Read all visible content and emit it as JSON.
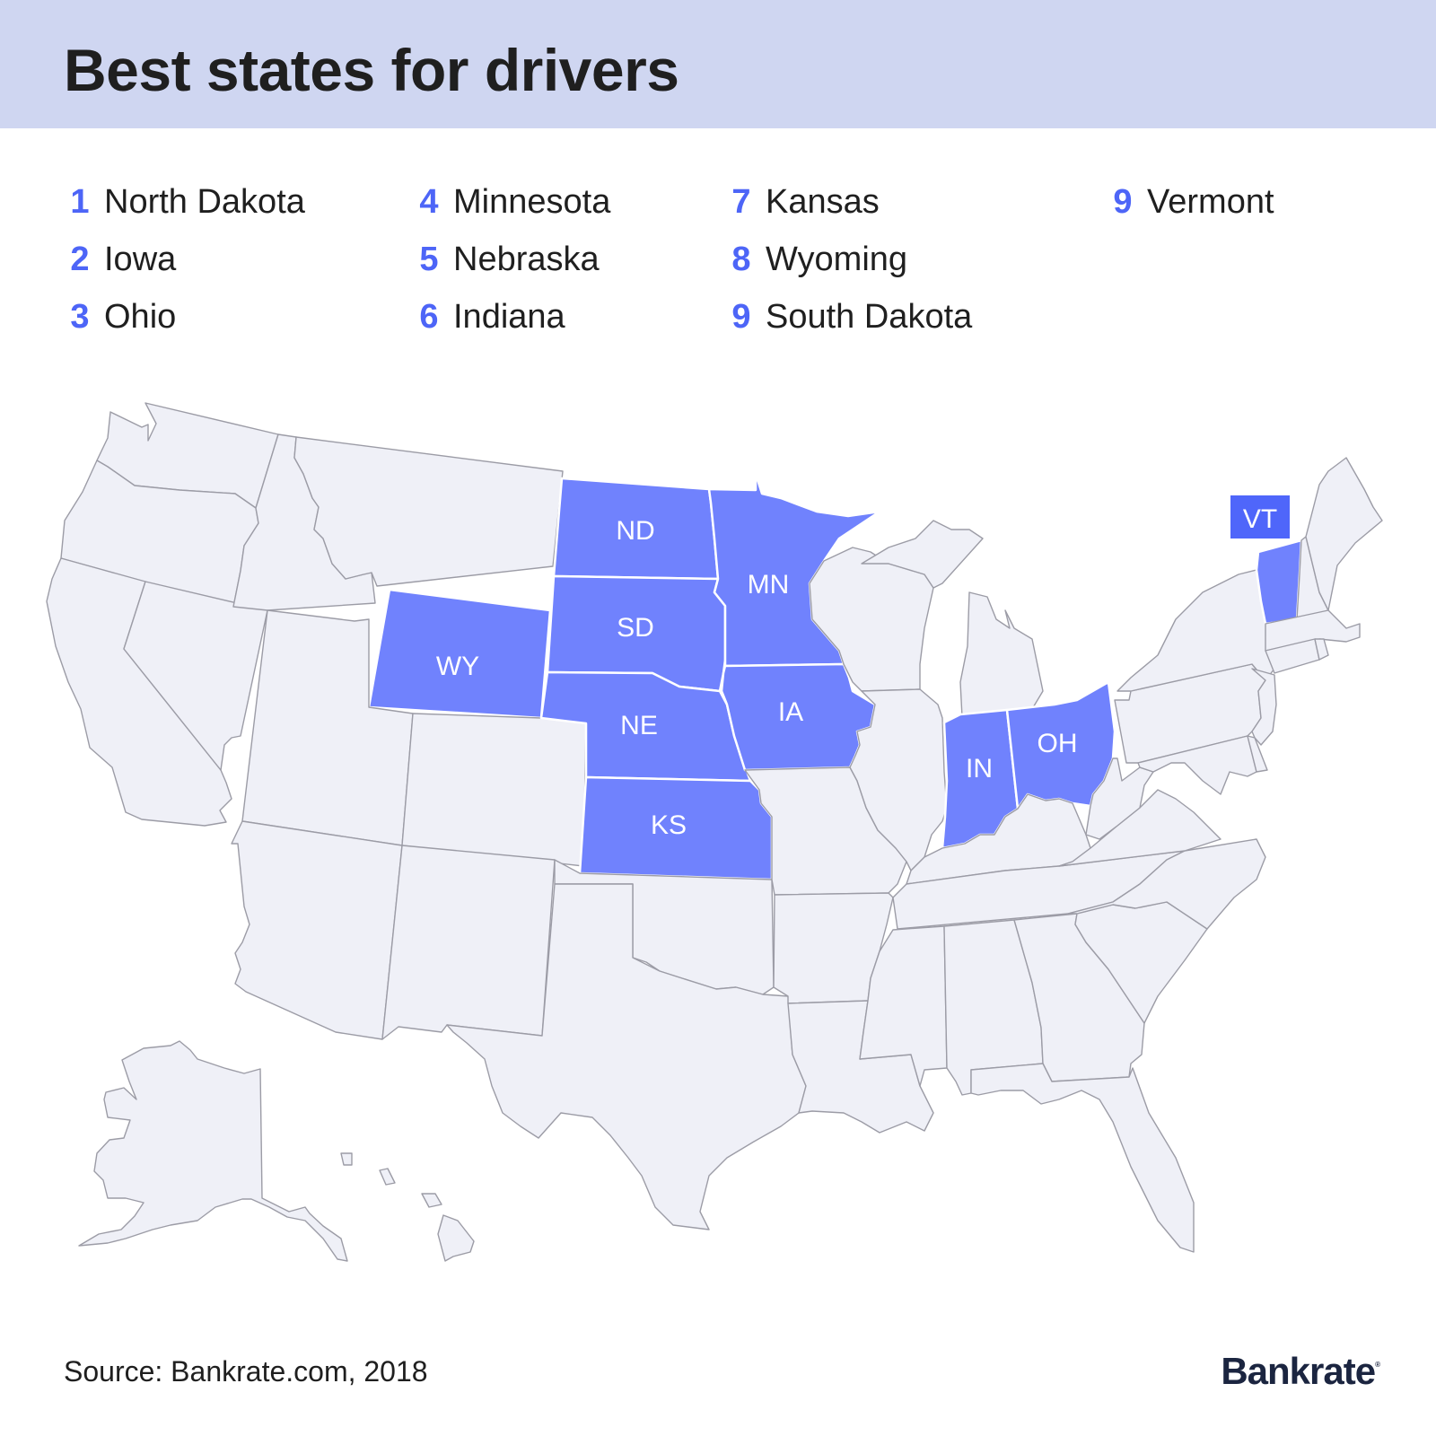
{
  "header": {
    "title": "Best states for drivers",
    "band_color": "#cfd6f1"
  },
  "colors": {
    "rank_number": "#4d65f7",
    "highlight_fill": "#7082fd",
    "base_fill": "#eff0f7",
    "badge": "#4f66fa"
  },
  "rankings": [
    {
      "rank": "1",
      "state": "North Dakota"
    },
    {
      "rank": "2",
      "state": "Iowa"
    },
    {
      "rank": "3",
      "state": "Ohio"
    },
    {
      "rank": "4",
      "state": "Minnesota"
    },
    {
      "rank": "5",
      "state": "Nebraska"
    },
    {
      "rank": "6",
      "state": "Indiana"
    },
    {
      "rank": "7",
      "state": "Kansas"
    },
    {
      "rank": "8",
      "state": "Wyoming"
    },
    {
      "rank": "9",
      "state": "South Dakota"
    },
    {
      "rank": "9",
      "state": "Vermont"
    }
  ],
  "map": {
    "highlighted_states": [
      "ND",
      "SD",
      "NE",
      "KS",
      "MN",
      "IA",
      "WY",
      "IN",
      "OH",
      "VT"
    ],
    "labels": {
      "ND": "ND",
      "SD": "SD",
      "NE": "NE",
      "KS": "KS",
      "MN": "MN",
      "IA": "IA",
      "WY": "WY",
      "IN": "IN",
      "OH": "OH",
      "VT": "VT"
    }
  },
  "footer": {
    "source": "Source: Bankrate.com, 2018",
    "logo": "Bankrate"
  }
}
